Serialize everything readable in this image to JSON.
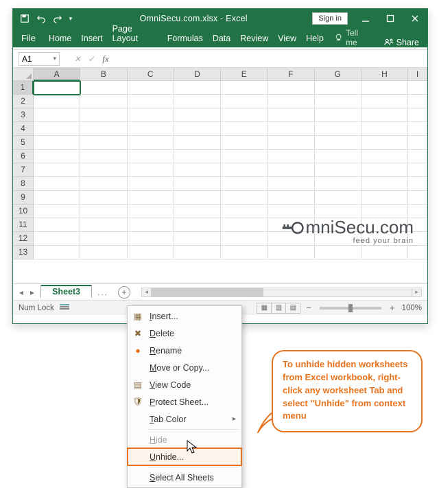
{
  "title": "OmniSecu.com.xlsx - Excel",
  "signin": "Sign in",
  "ribbon": {
    "file": "File",
    "tabs": [
      "Home",
      "Insert",
      "Page Layout",
      "Formulas",
      "Data",
      "Review",
      "View",
      "Help"
    ],
    "tellme": "Tell me",
    "share": "Share"
  },
  "formula": {
    "namebox": "A1",
    "cancel": "✕",
    "enter": "✓",
    "fx": "fx"
  },
  "columns": [
    "A",
    "B",
    "C",
    "D",
    "E",
    "F",
    "G",
    "H",
    "I"
  ],
  "rows": [
    "1",
    "2",
    "3",
    "4",
    "5",
    "6",
    "7",
    "8",
    "9",
    "10",
    "11",
    "12",
    "13"
  ],
  "sheet": {
    "active": "Sheet3",
    "dots": "...",
    "add": "+"
  },
  "status": {
    "numlock": "Num Lock",
    "zoom": "100%"
  },
  "context_menu": {
    "insert": "Insert...",
    "delete": "Delete",
    "rename": "Rename",
    "move": "Move or Copy...",
    "viewcode": "View Code",
    "protect": "Protect Sheet...",
    "tabcolor": "Tab Color",
    "hide": "Hide",
    "unhide": "Unhide...",
    "selectall": "Select All Sheets"
  },
  "logo": {
    "text": "mniSecu.com",
    "tag": "feed your brain"
  },
  "callout": "To unhide hidden worksheets from Excel workbook, right-click any worksheet Tab and select \"Unhide\" from context menu"
}
